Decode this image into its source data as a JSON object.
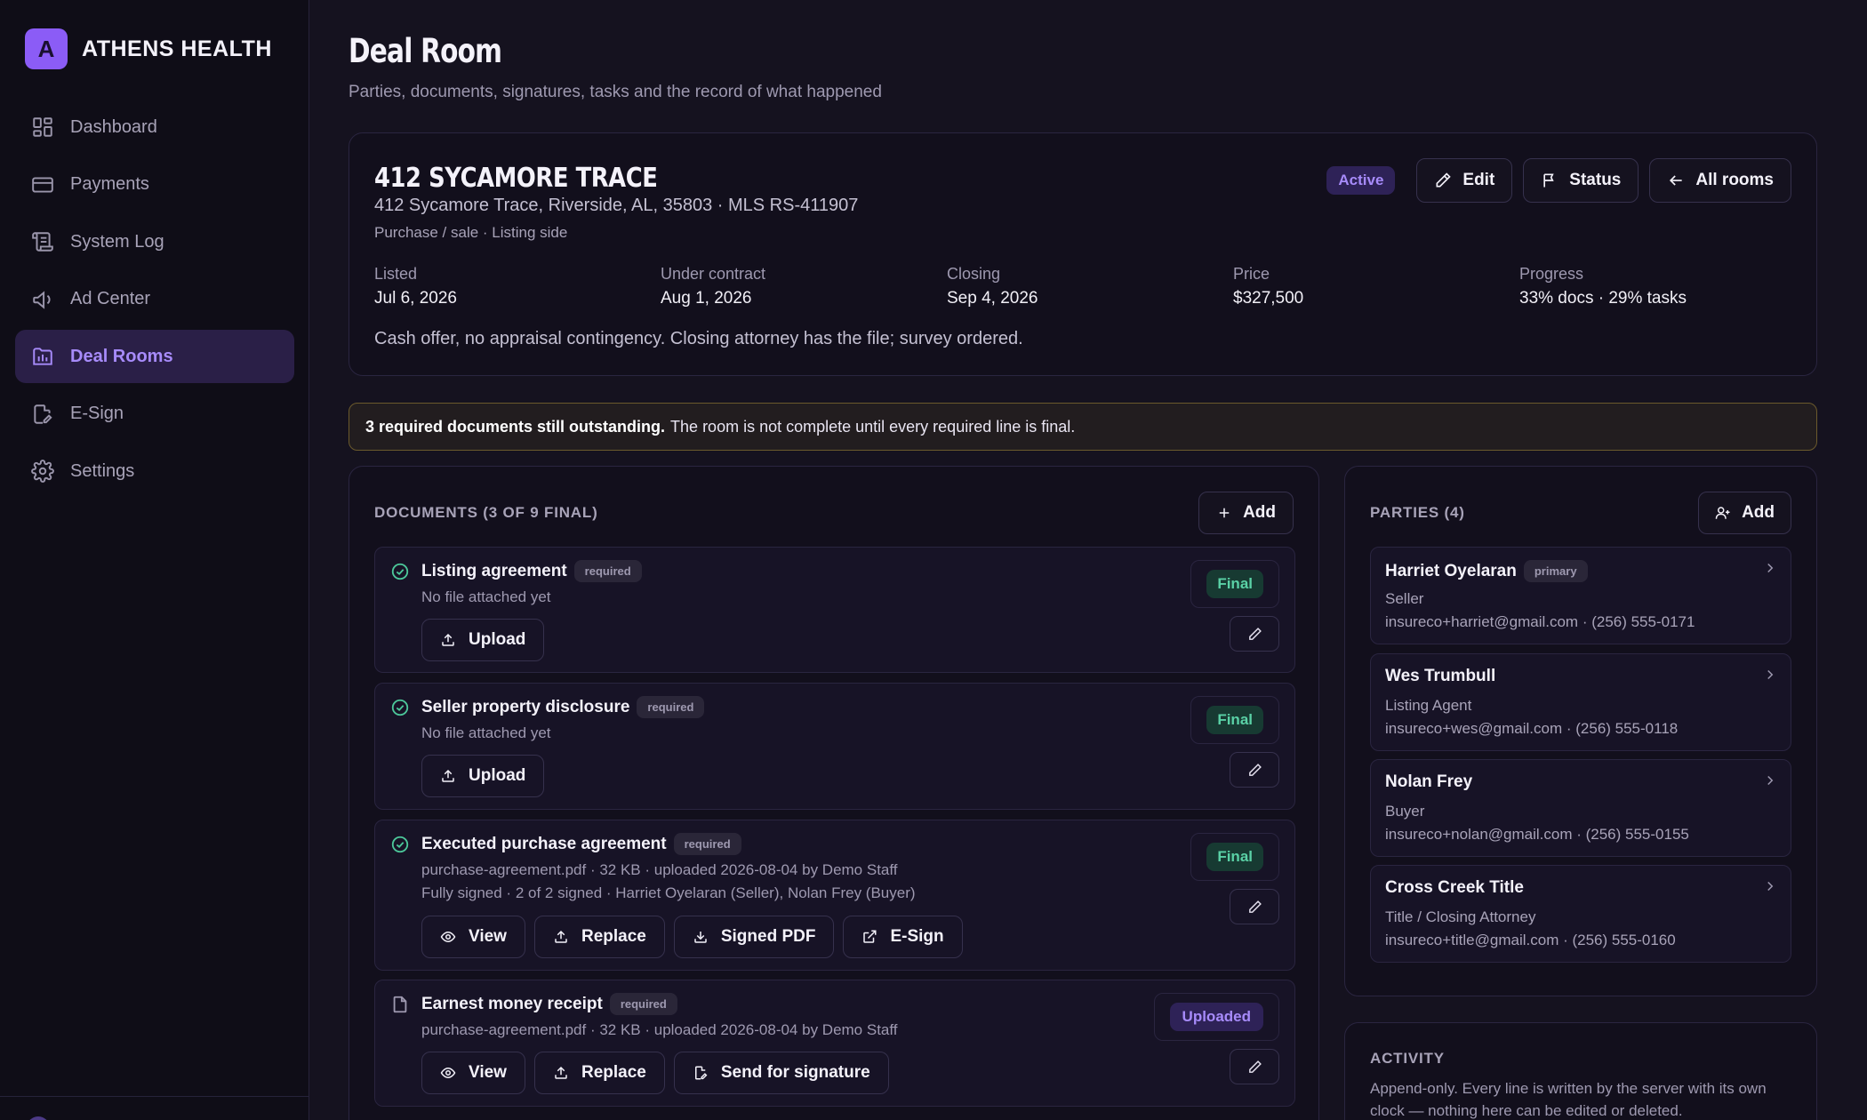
{
  "brand": {
    "logo_letter": "A",
    "name": "ATHENS HEALTH",
    "accent": "#8b5cf6"
  },
  "nav": {
    "items": [
      {
        "label": "Dashboard",
        "icon": "dashboard-icon"
      },
      {
        "label": "Payments",
        "icon": "credit-card-icon"
      },
      {
        "label": "System Log",
        "icon": "scroll-icon"
      },
      {
        "label": "Ad Center",
        "icon": "megaphone-icon"
      },
      {
        "label": "Deal Rooms",
        "icon": "deal-room-icon",
        "active": true
      },
      {
        "label": "E-Sign",
        "icon": "file-signature-icon"
      },
      {
        "label": "Settings",
        "icon": "gear-icon"
      }
    ]
  },
  "page": {
    "title": "Deal Room",
    "subtitle": "Parties, documents, signatures, tasks and the record of what happened"
  },
  "property": {
    "title": "412 SYCAMORE TRACE",
    "address": "412 Sycamore Trace, Riverside, AL, 35803 · MLS RS-411907",
    "type": "Purchase / sale · Listing side",
    "status": "Active",
    "actions": {
      "edit": "Edit",
      "status": "Status",
      "all_rooms": "All rooms"
    },
    "stats": [
      {
        "label": "Listed",
        "value": "Jul 6, 2026"
      },
      {
        "label": "Under contract",
        "value": "Aug 1, 2026"
      },
      {
        "label": "Closing",
        "value": "Sep 4, 2026"
      },
      {
        "label": "Price",
        "value": "$327,500"
      },
      {
        "label": "Progress",
        "value": "33% docs · 29% tasks"
      }
    ],
    "note": "Cash offer, no appraisal contingency. Closing attorney has the file; survey ordered."
  },
  "alert": {
    "strong": "3 required documents still outstanding.",
    "text": "The room is not complete until every required line is final.",
    "color": "#6b5a2c"
  },
  "documents": {
    "heading": "DOCUMENTS (3 OF 9 FINAL)",
    "add_label": "Add",
    "items": [
      {
        "name": "Listing agreement",
        "required": "required",
        "meta": [
          "No file attached yet"
        ],
        "status": "Final",
        "actions": [
          "Upload"
        ]
      },
      {
        "name": "Seller property disclosure",
        "required": "required",
        "meta": [
          "No file attached yet"
        ],
        "status": "Final",
        "actions": [
          "Upload"
        ]
      },
      {
        "name": "Executed purchase agreement",
        "required": "required",
        "meta": [
          "purchase-agreement.pdf · 32 KB · uploaded 2026-08-04 by Demo Staff",
          "Fully signed · 2 of 2 signed · Harriet Oyelaran (Seller), Nolan Frey (Buyer)"
        ],
        "status": "Final",
        "actions": [
          "View",
          "Replace",
          "Signed PDF",
          "E-Sign"
        ]
      },
      {
        "name": "Earnest money receipt",
        "required": "required",
        "meta": [
          "purchase-agreement.pdf · 32 KB · uploaded 2026-08-04 by Demo Staff"
        ],
        "status": "Uploaded",
        "actions": [
          "View",
          "Replace",
          "Send for signature"
        ]
      }
    ]
  },
  "parties": {
    "heading": "PARTIES (4)",
    "add_label": "Add",
    "items": [
      {
        "name": "Harriet Oyelaran",
        "tag": "primary",
        "role": "Seller",
        "contact": "insureco+harriet@gmail.com · (256) 555-0171"
      },
      {
        "name": "Wes Trumbull",
        "role": "Listing Agent",
        "contact": "insureco+wes@gmail.com · (256) 555-0118"
      },
      {
        "name": "Nolan Frey",
        "role": "Buyer",
        "contact": "insureco+nolan@gmail.com · (256) 555-0155"
      },
      {
        "name": "Cross Creek Title",
        "role": "Title / Closing Attorney",
        "contact": "insureco+title@gmail.com · (256) 555-0160"
      }
    ]
  },
  "activity": {
    "heading": "ACTIVITY",
    "description": "Append-only. Every line is written by the server with its own clock — nothing here can be edited or deleted."
  }
}
